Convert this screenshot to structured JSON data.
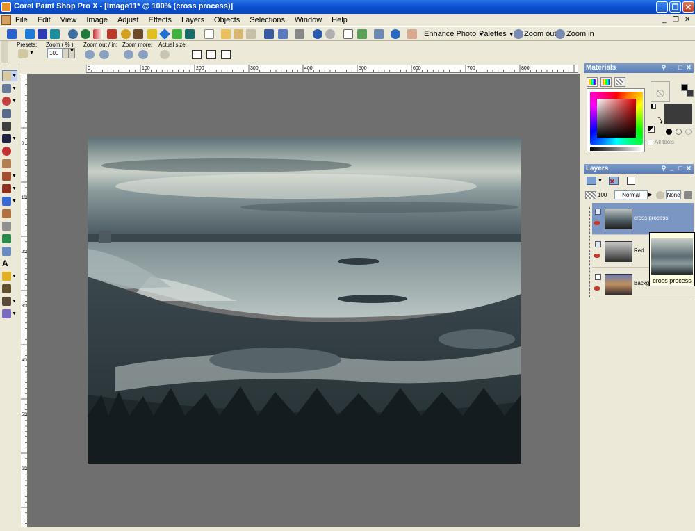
{
  "window": {
    "title": "Corel Paint Shop Pro X - [Image11* @ 100% (cross process)]"
  },
  "menu": [
    "File",
    "Edit",
    "View",
    "Image",
    "Adjust",
    "Effects",
    "Layers",
    "Objects",
    "Selections",
    "Window",
    "Help"
  ],
  "toolbar": {
    "enhance_photo": "Enhance Photo",
    "palettes": "Palettes",
    "zoom_out": "Zoom out",
    "zoom_in": "Zoom in"
  },
  "tool_options": {
    "presets_label": "Presets:",
    "zoom_label": "Zoom ( % ):",
    "zoom_value": "100",
    "zoom_out_in_label": "Zoom out / in:",
    "zoom_more_label": "Zoom more:",
    "actual_size_label": "Actual size:"
  },
  "ruler_h_labels": [
    "0",
    "100",
    "200",
    "300",
    "400",
    "500",
    "600",
    "700",
    "800"
  ],
  "ruler_v_labels": [
    "0",
    "100",
    "200",
    "300",
    "400",
    "500",
    "600"
  ],
  "materials": {
    "title": "Materials",
    "all_tools_label": "All tools",
    "foreground_color": "#000000",
    "background_color": "#3a3a3a"
  },
  "layers": {
    "title": "Layers",
    "opacity": "100",
    "blend_mode": "Normal",
    "mask": "None",
    "items": [
      {
        "name": "cross process",
        "selected": true
      },
      {
        "name": "Red",
        "selected": false
      },
      {
        "name": "Backgr",
        "selected": false
      }
    ],
    "tooltip": "cross process"
  },
  "colors": {
    "accent": "#0a4fd0",
    "layer_selected": "#7b96c2",
    "canvas_bg": "#6f6f6f"
  }
}
